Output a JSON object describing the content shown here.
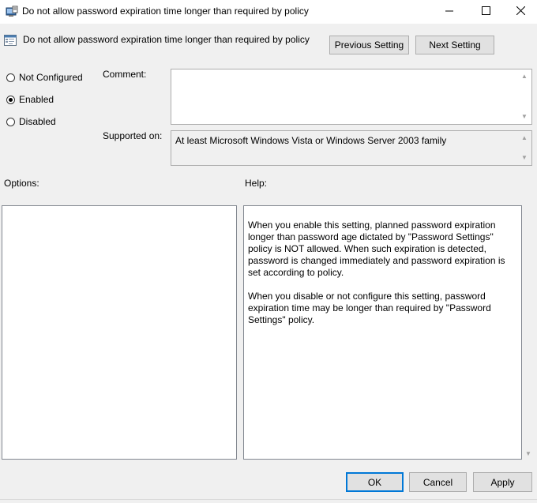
{
  "window": {
    "title": "Do not allow password expiration time longer than required by policy"
  },
  "header": {
    "policy_name": "Do not allow password expiration time longer than required by policy",
    "previous_label": "Previous Setting",
    "next_label": "Next Setting"
  },
  "state": {
    "options": [
      {
        "label": "Not Configured",
        "selected": false
      },
      {
        "label": "Enabled",
        "selected": true
      },
      {
        "label": "Disabled",
        "selected": false
      }
    ]
  },
  "comment": {
    "label": "Comment:",
    "value": ""
  },
  "supported": {
    "label": "Supported on:",
    "value": "At least Microsoft Windows Vista or Windows Server 2003 family"
  },
  "options_section": {
    "label": "Options:"
  },
  "help_section": {
    "label": "Help:",
    "paragraphs": [
      "When you enable this setting, planned password expiration longer than password age dictated by \"Password Settings\" policy is NOT allowed. When such expiration is detected, password is changed immediately and password expiration is set according to policy.",
      "When you disable or not configure this setting, password expiration time may be longer than required by \"Password Settings\" policy."
    ]
  },
  "footer": {
    "ok_label": "OK",
    "cancel_label": "Cancel",
    "apply_label": "Apply"
  },
  "icons": {
    "app": "policy-editor-icon",
    "policy": "policy-setting-icon",
    "minimize": "minimize-icon",
    "maximize": "maximize-icon",
    "close": "close-icon"
  },
  "colors": {
    "accent": "#0078d7",
    "window_bg": "#f0f0f0"
  }
}
